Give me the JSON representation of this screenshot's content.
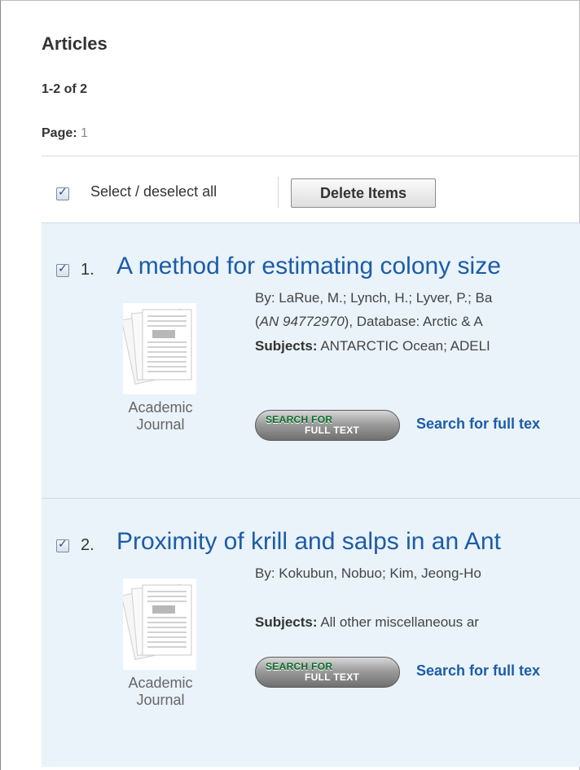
{
  "section_title": "Articles",
  "result_count": "1-2 of 2",
  "page": {
    "label": "Page:",
    "number": "1"
  },
  "toolbar": {
    "select_all_label": "Select / deselect all",
    "delete_label": "Delete Items"
  },
  "results": [
    {
      "number": "1.",
      "title": "A method for estimating colony size",
      "byline": "By: LaRue, M.; Lynch, H.; Lyver, P.; Ba",
      "accession_prefix": "(",
      "accession": "AN 94772970",
      "database_text": "), Database: Arctic & A",
      "subjects_label": "Subjects:",
      "subjects_text": " ANTARCTIC Ocean; ADELI",
      "pub_type": [
        "Academic",
        "Journal"
      ],
      "sft_button": {
        "line1": "SEARCH FOR",
        "line2": "FULL TEXT"
      },
      "fulltext_link": "Search for full tex"
    },
    {
      "number": "2.",
      "title": "Proximity of krill and salps in an Ant",
      "byline": "By: Kokubun, Nobuo; Kim, Jeong-Ho",
      "subjects_label": "Subjects:",
      "subjects_text": " All other miscellaneous ar",
      "pub_type": [
        "Academic",
        "Journal"
      ],
      "sft_button": {
        "line1": "SEARCH FOR",
        "line2": "FULL TEXT"
      },
      "fulltext_link": "Search for full tex"
    }
  ],
  "icons": {
    "checkbox": "checkbox-checked-icon",
    "document": "document-stack-icon"
  },
  "colors": {
    "link": "#1c5ca8",
    "result_bg": "#eaf3fa",
    "sft_green": "#0c6b2a"
  }
}
